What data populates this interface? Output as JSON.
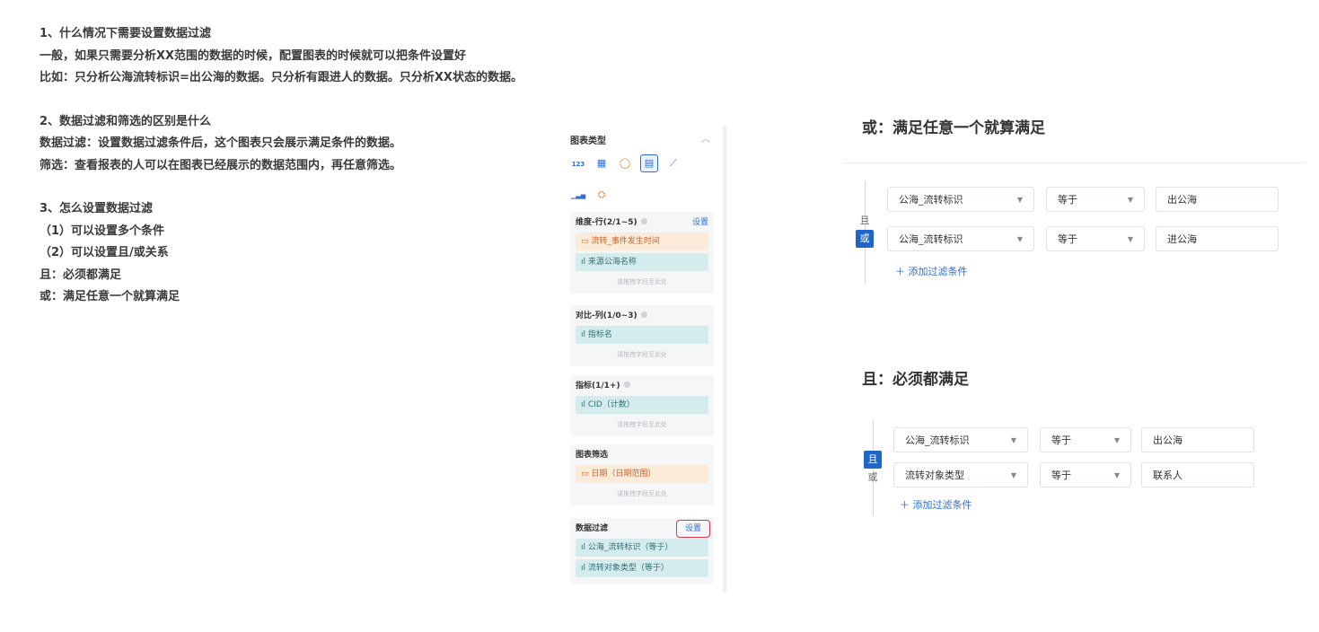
{
  "doc": {
    "lines": [
      "1、什么情况下需要设置数据过滤",
      "一般，如果只需要分析XX范围的数据的时候，配置图表的时候就可以把条件设置好",
      "比如：只分析公海流转标识=出公海的数据。只分析有跟进人的数据。只分析XX状态的数据。",
      "",
      "2、数据过滤和筛选的区别是什么",
      "数据过滤：设置数据过滤条件后，这个图表只会展示满足条件的数据。",
      "筛选：查看报表的人可以在图表已经展示的数据范围内，再任意筛选。",
      "",
      "3、怎么设置数据过滤",
      "（1）可以设置多个条件",
      "（2）可以设置且/或关系",
      "且：必须都满足",
      "或：满足任意一个就算满足"
    ]
  },
  "panel": {
    "title": "图表类型",
    "collapse_icon": "chevron-up-icon",
    "chart_types": [
      {
        "name": "number-card-icon",
        "glyph": "123",
        "selected": false
      },
      {
        "name": "table-icon",
        "glyph": "▦",
        "selected": false
      },
      {
        "name": "donut-icon",
        "glyph": "◯",
        "selected": false
      },
      {
        "name": "pivot-table-icon",
        "glyph": "▤",
        "selected": true
      },
      {
        "name": "line-chart-icon",
        "glyph": "⟋",
        "selected": false
      },
      {
        "name": "bar-chart-icon",
        "glyph": "▁▃▅",
        "selected": false
      },
      {
        "name": "funnel-icon",
        "glyph": "⛭",
        "selected": false
      }
    ],
    "sections": {
      "dimension": {
        "label": "维度-行(2/1~5)",
        "set": "设置",
        "items": [
          "流转_事件发生时间",
          "来源公海名称"
        ],
        "drop": "请拖拽字段至此处"
      },
      "compare": {
        "label": "对比-列(1/0~3)",
        "items": [
          "指标名"
        ],
        "drop": "请拖拽字段至此处"
      },
      "metric": {
        "label": "指标(1/1+)",
        "items": [
          "CID（计数）"
        ],
        "drop": "请拖拽字段至此处"
      },
      "chart_filter": {
        "label": "图表筛选",
        "items": [
          "日期（日期范围）"
        ],
        "drop": "请拖拽字段至此处"
      },
      "data_filter": {
        "label": "数据过滤",
        "set": "设置",
        "items": [
          "公海_流转标识（等于）",
          "流转对象类型（等于）"
        ]
      }
    }
  },
  "or_panel": {
    "heading": "或：满足任意一个就算满足",
    "toggle": {
      "and": "且",
      "or": "或",
      "active": "or"
    },
    "rows": [
      {
        "field": "公海_流转标识",
        "op": "等于",
        "value": "出公海"
      },
      {
        "field": "公海_流转标识",
        "op": "等于",
        "value": "进公海"
      }
    ],
    "add": "＋ 添加过滤条件"
  },
  "and_panel": {
    "heading": "且：必须都满足",
    "toggle": {
      "and": "且",
      "or": "或",
      "active": "and"
    },
    "rows": [
      {
        "field": "公海_流转标识",
        "op": "等于",
        "value": "出公海"
      },
      {
        "field": "流转对象类型",
        "op": "等于",
        "value": "联系人"
      }
    ],
    "add": "＋ 添加过滤条件"
  },
  "colors": {
    "accent": "#2065c8",
    "highlight": "#e03545"
  }
}
